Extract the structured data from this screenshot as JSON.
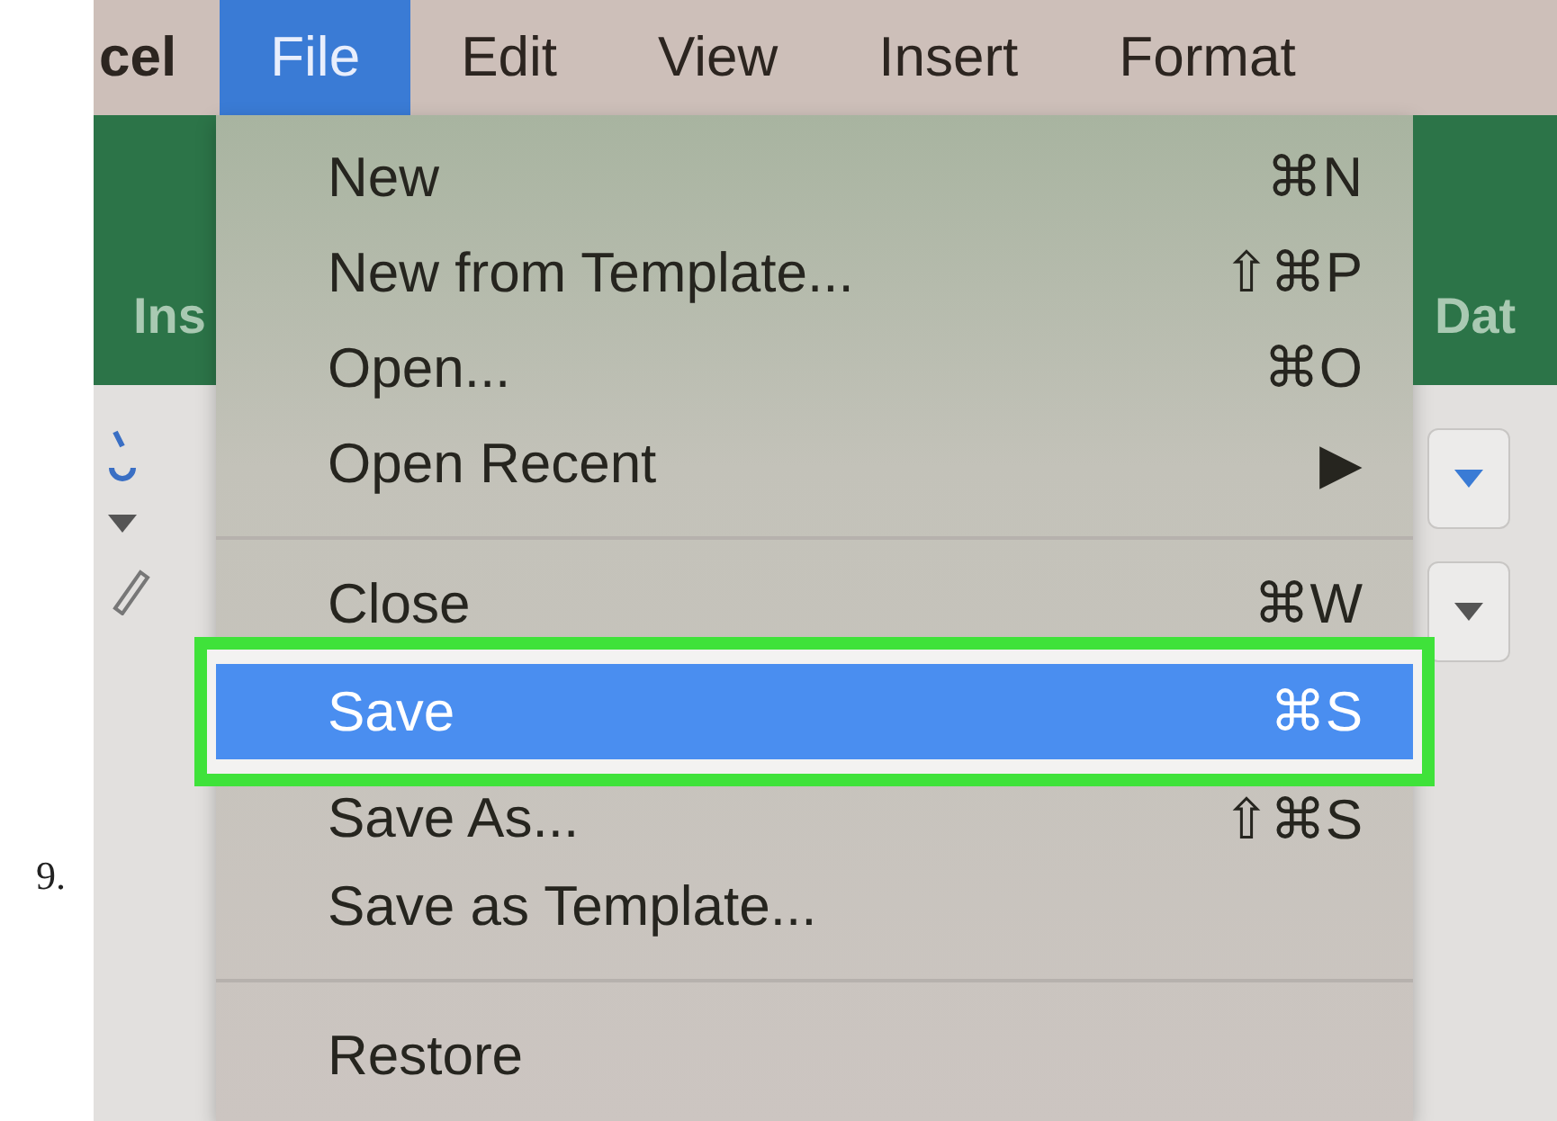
{
  "step_number": "9.",
  "menu_bar": [
    {
      "label": "cel",
      "selected": false
    },
    {
      "label": "File",
      "selected": true
    },
    {
      "label": "Edit",
      "selected": false
    },
    {
      "label": "View",
      "selected": false
    },
    {
      "label": "Insert",
      "selected": false
    },
    {
      "label": "Format",
      "selected": false
    }
  ],
  "ribbon_tabs": [
    "Ins",
    "Dat"
  ],
  "file_menu": [
    {
      "kind": "item",
      "label": "New",
      "shortcut": "⌘N",
      "selected": false
    },
    {
      "kind": "item",
      "label": "New from Template...",
      "shortcut": "⇧⌘P",
      "selected": false
    },
    {
      "kind": "item",
      "label": "Open...",
      "shortcut": "⌘O",
      "selected": false
    },
    {
      "kind": "item",
      "label": "Open Recent",
      "shortcut": "▶",
      "selected": false
    },
    {
      "kind": "separator"
    },
    {
      "kind": "item",
      "label": "Close",
      "shortcut": "⌘W",
      "selected": false
    },
    {
      "kind": "item",
      "label": "Save",
      "shortcut": "⌘S",
      "selected": true
    },
    {
      "kind": "item",
      "label": "Save As...",
      "shortcut": "⇧⌘S",
      "selected": false
    },
    {
      "kind": "item",
      "label": "Save as Template...",
      "selected": false
    },
    {
      "kind": "separator"
    },
    {
      "kind": "item",
      "label": "Restore",
      "selected": false
    }
  ]
}
